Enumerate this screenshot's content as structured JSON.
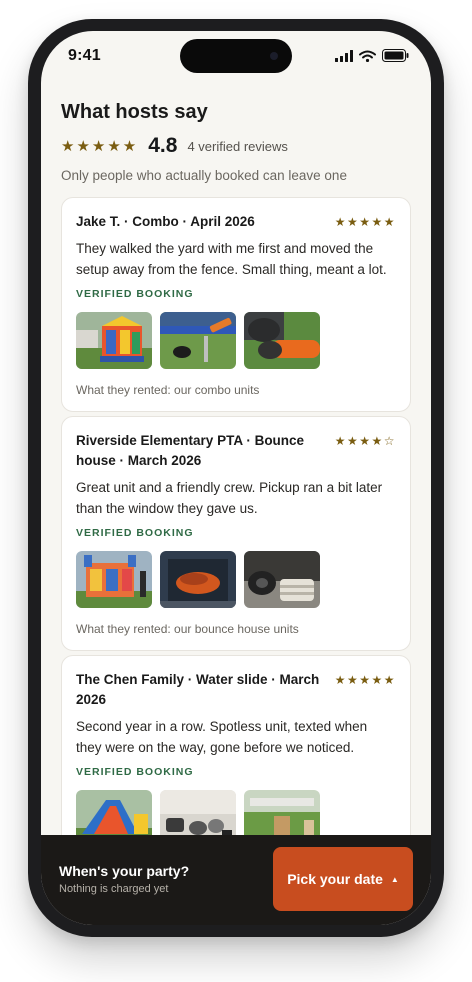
{
  "status": {
    "time": "9:41"
  },
  "reviews_section": {
    "title": "What hosts say",
    "summary_stars": "★★★★★",
    "rating": "4.8",
    "count_text": "4 verified reviews",
    "note": "Only people who actually booked can leave one"
  },
  "reviews": [
    {
      "title": "Jake T. · Combo · April 2026",
      "stars": "★★★★★",
      "rating": 5,
      "body": "They walked the yard with me first and moved the setup away from the fence. Small thing, meant a lot.",
      "verified": "VERIFIED BOOKING",
      "photos": [
        "combo-bounce-house-photo",
        "stake-hammer-photo",
        "worker-gloves-photo"
      ],
      "rented": "What they rented: our combo units"
    },
    {
      "title": "Riverside Elementary PTA · Bounce house · March 2026",
      "stars": "★★★★☆",
      "rating": 4,
      "body": "Great unit and a friendly crew. Pickup ran a bit later than the window they gave us.",
      "verified": "VERIFIED BOOKING",
      "photos": [
        "bounce-house-photo",
        "van-cargo-photo",
        "rolled-unit-photo"
      ],
      "rented": "What they rented: our bounce house units"
    },
    {
      "title": "The Chen Family · Water slide · March 2026",
      "stars": "★★★★★",
      "rating": 5,
      "body": "Second year in a row. Spotless unit, texted when they were on the way, gone before we noticed.",
      "verified": "VERIFIED BOOKING",
      "photos": [
        "water-slide-photo",
        "blowers-garage-photo",
        "yard-setup-photo"
      ],
      "rented": ""
    }
  ],
  "bottom_bar": {
    "question": "When's your party?",
    "note": "Nothing is charged yet",
    "cta_label": "Pick your date",
    "cta_color": "#c84d1f"
  }
}
